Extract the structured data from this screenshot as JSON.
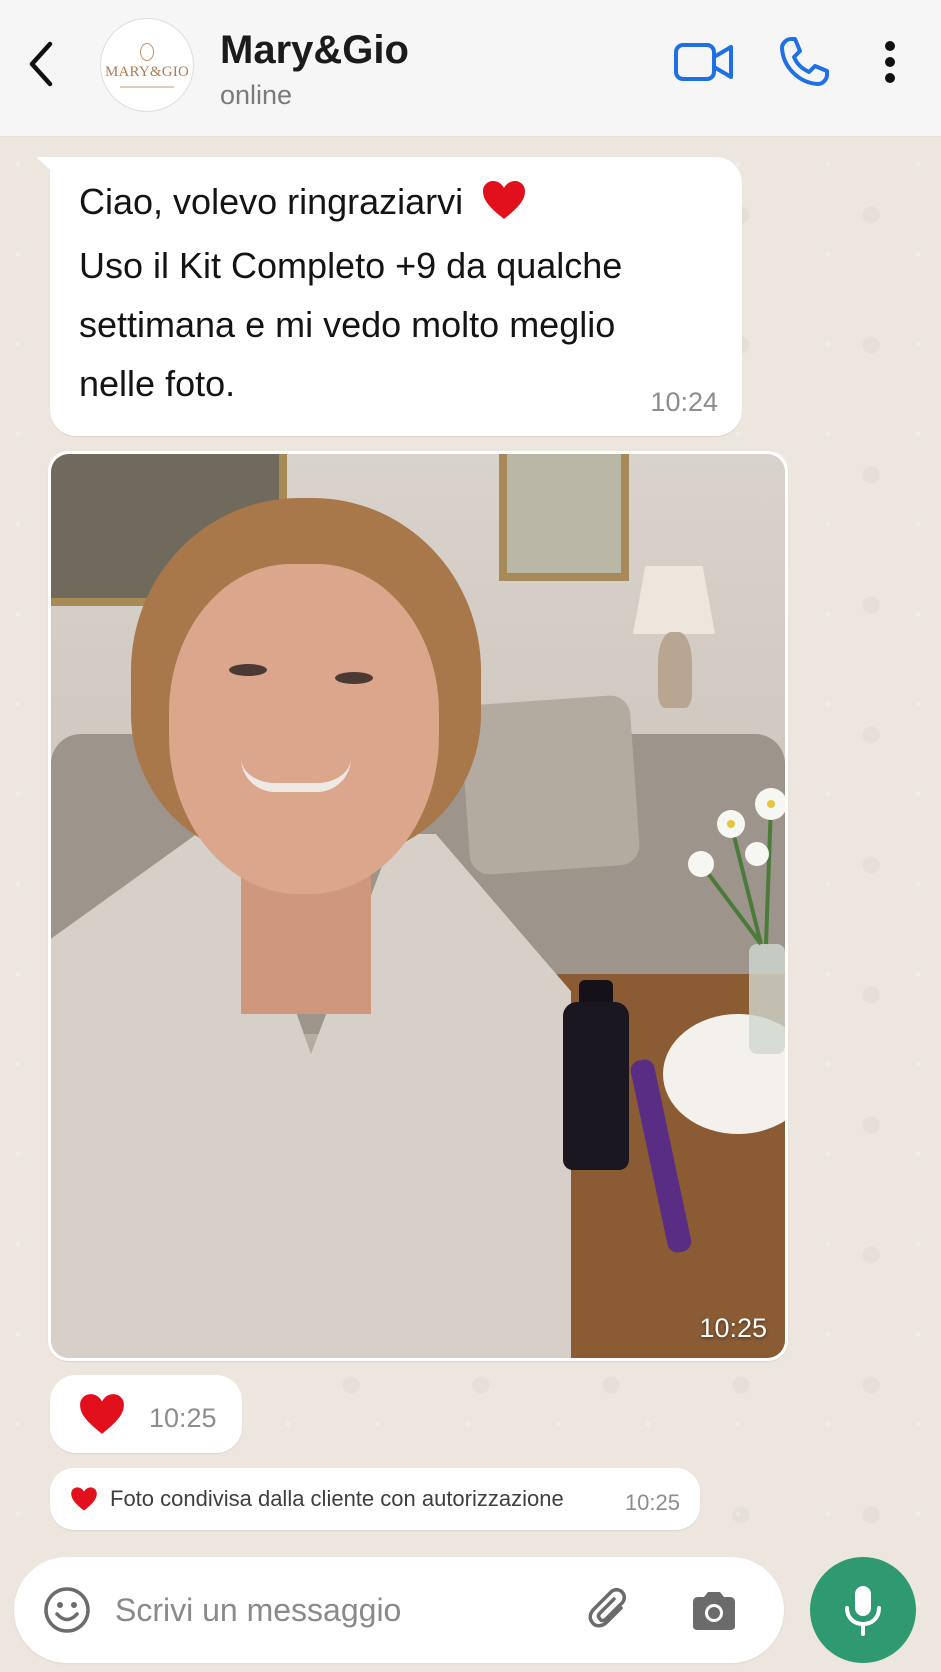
{
  "header": {
    "contact_name": "Mary&Gio",
    "status": "online",
    "avatar_text": "MARY&GIO"
  },
  "messages": [
    {
      "lines": [
        "Ciao, volevo ringraziarvi",
        "Uso il Kit Completo +9 da qualche",
        "settimana e mi vedo molto meglio",
        "nelle foto."
      ],
      "time": "10:24"
    },
    {
      "type": "photo",
      "time": "10:25"
    },
    {
      "type": "heart",
      "time": "10:25"
    },
    {
      "text": "Foto condivisa dalla cliente con autorizzazione",
      "time": "10:25"
    }
  ],
  "composer": {
    "placeholder": "Scrivi un messaggio"
  },
  "colors": {
    "accent_blue": "#1f6fe6",
    "mic_green": "#2f9a72",
    "heart_red": "#e2101c",
    "chat_bg": "#ece6de"
  },
  "icons": [
    "back-arrow-icon",
    "video-call-icon",
    "phone-icon",
    "more-vertical-icon",
    "heart-icon",
    "emoji-icon",
    "attach-icon",
    "camera-icon",
    "microphone-icon"
  ]
}
